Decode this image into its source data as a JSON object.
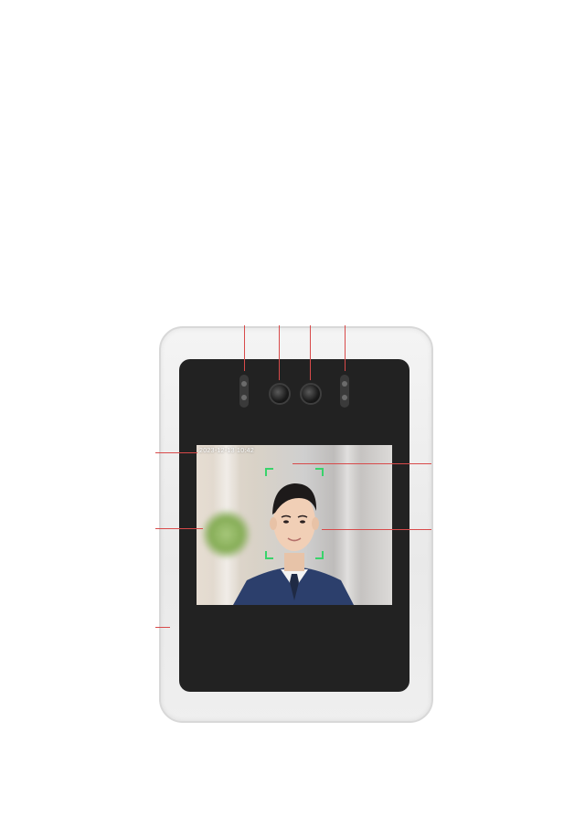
{
  "screen": {
    "timestamp": "2023-12-13 10:42"
  },
  "colors": {
    "background": "#ffffff",
    "device_frame": "#efefef",
    "bezel": "#222222",
    "callout_lines": "#d84a4a",
    "face_frame": "#39d36b",
    "suit": "#2c3f6c"
  },
  "icons": {
    "face_detection_frame": "face-detection-frame-icon",
    "camera_lens": "camera-lens-icon",
    "ir_sensor": "ir-sensor-icon"
  }
}
